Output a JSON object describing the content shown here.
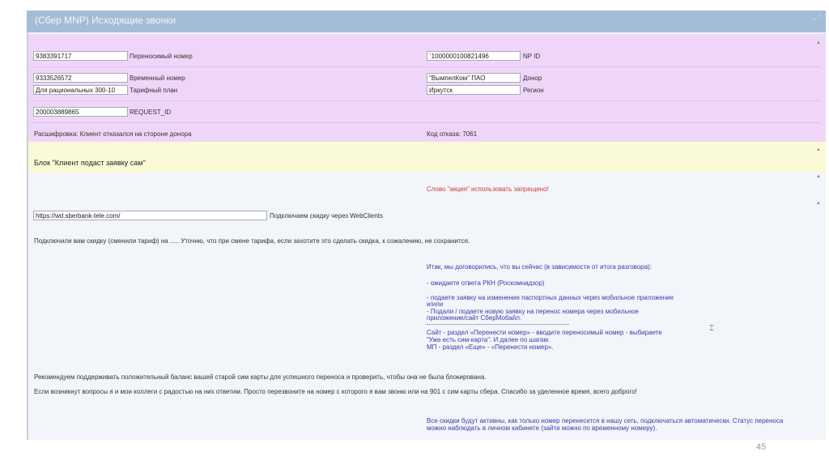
{
  "window": {
    "title": "(Сбер MNP) Исходящие звонки"
  },
  "fields": {
    "ported_number": {
      "value": "9383391717",
      "label": "Переносимый номер"
    },
    "np_id": {
      "value": "`1000000100821496",
      "label": "NP ID"
    },
    "temp_number": {
      "value": "9333526572",
      "label": "Временный номер"
    },
    "donor": {
      "value": "\"ВымпелКом\" ПАО",
      "label": "Донор"
    },
    "tariff": {
      "value": "Для рациональных 300-10",
      "label": "Тарифный план"
    },
    "region": {
      "value": "Иркутск",
      "label": "Регион"
    },
    "request_id": {
      "value": "200003889865",
      "label": "REQUEST_ID"
    }
  },
  "decoding": "Расшифровка: Клиент отказался на стороне донора",
  "refusal_code": "Код отказа: 7061",
  "block_title": "Блок \"Клиент подаст заявку сам\"",
  "warning": "Слово \"акция\" использовать запрещено!",
  "webclients": {
    "url": "https://wd.sberbank-tele.com/",
    "label": "Подключаем скидку через WebClients"
  },
  "script_lines": [
    "Подключили вам скидку (сменили тариф) на ..... Уточню, что при смене тарифа, если захотите это сделать скидка, к сожалению, не сохранится.",
    "Рекомендуем поддерживать положительный баланс вашей старой сим карты для успешного переноса и проверить, чтобы она не была блокирована.",
    "Если возникнут вопросы я и мои коллеги с радостью на них ответим. Просто перезвоните на номер с которого я вам звоню или на 901 с сим карты сбера. Спасибо за уделенное время, всего доброго!"
  ],
  "agreement": [
    "Итак, мы договорились, что вы сейчас (в зависимости от итога разговора):",
    "- ожидаете ответа РКН (Роскомнадзор)",
    "- подаете заявку на изменение паспортных данных через мобильное приложение",
    "и/или",
    "- Подали / подаете новую заявку на перенос номера через мобильное",
    "приложение/сайт СберМобайл.",
    "Сайт - раздел «Перенести номер» - вводите переносимый номер - выбираете",
    "\"Уже есть сим-карта\". И далее по шагам.",
    "МП - раздел «Еще» - «Перенести номер»."
  ],
  "discount_note": [
    "Все скидки будут активны, как только номер перенесется в нашу сеть, подключаться автоматически. Статус переноса",
    "можно наблюдать в личном кабинете (зайти можно по временному номеру)."
  ],
  "page_number": "45"
}
